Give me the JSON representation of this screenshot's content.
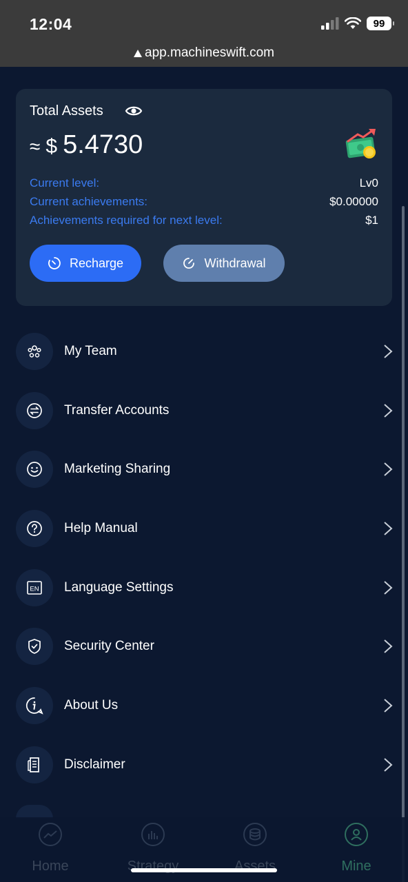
{
  "status_bar": {
    "time": "12:04",
    "battery": "99"
  },
  "browser": {
    "url": "app.machineswift.com"
  },
  "assets_card": {
    "title": "Total Assets",
    "approx_symbol": "≈",
    "currency_symbol": "$",
    "amount": "5.4730",
    "rows": [
      {
        "label": "Current level:",
        "value": "Lv0"
      },
      {
        "label": "Current achievements:",
        "value": "$0.00000"
      },
      {
        "label": "Achievements required for next level:",
        "value": "$1"
      }
    ],
    "recharge_label": "Recharge",
    "withdrawal_label": "Withdrawal"
  },
  "menu": [
    {
      "label": "My Team",
      "icon": "team-icon"
    },
    {
      "label": "Transfer Accounts",
      "icon": "transfer-icon"
    },
    {
      "label": "Marketing Sharing",
      "icon": "smile-icon"
    },
    {
      "label": "Help Manual",
      "icon": "question-icon"
    },
    {
      "label": "Language Settings",
      "icon": "language-icon",
      "icon_text": "EN"
    },
    {
      "label": "Security Center",
      "icon": "shield-icon"
    },
    {
      "label": "About Us",
      "icon": "info-icon"
    },
    {
      "label": "Disclaimer",
      "icon": "document-icon"
    }
  ],
  "bottom_nav": [
    {
      "label": "Home",
      "icon": "chart-line-icon",
      "active": false
    },
    {
      "label": "Strategy",
      "icon": "chart-bar-icon",
      "active": false
    },
    {
      "label": "Assets",
      "icon": "coins-icon",
      "active": false
    },
    {
      "label": "Mine",
      "icon": "user-icon",
      "active": true
    }
  ],
  "colors": {
    "background": "#0c1830",
    "card": "#1b2a3e",
    "accent_blue": "#2c6cf5",
    "label_blue": "#3b7bf0",
    "withdraw_button": "#5f7fad",
    "nav_active": "#2f6f5f"
  }
}
